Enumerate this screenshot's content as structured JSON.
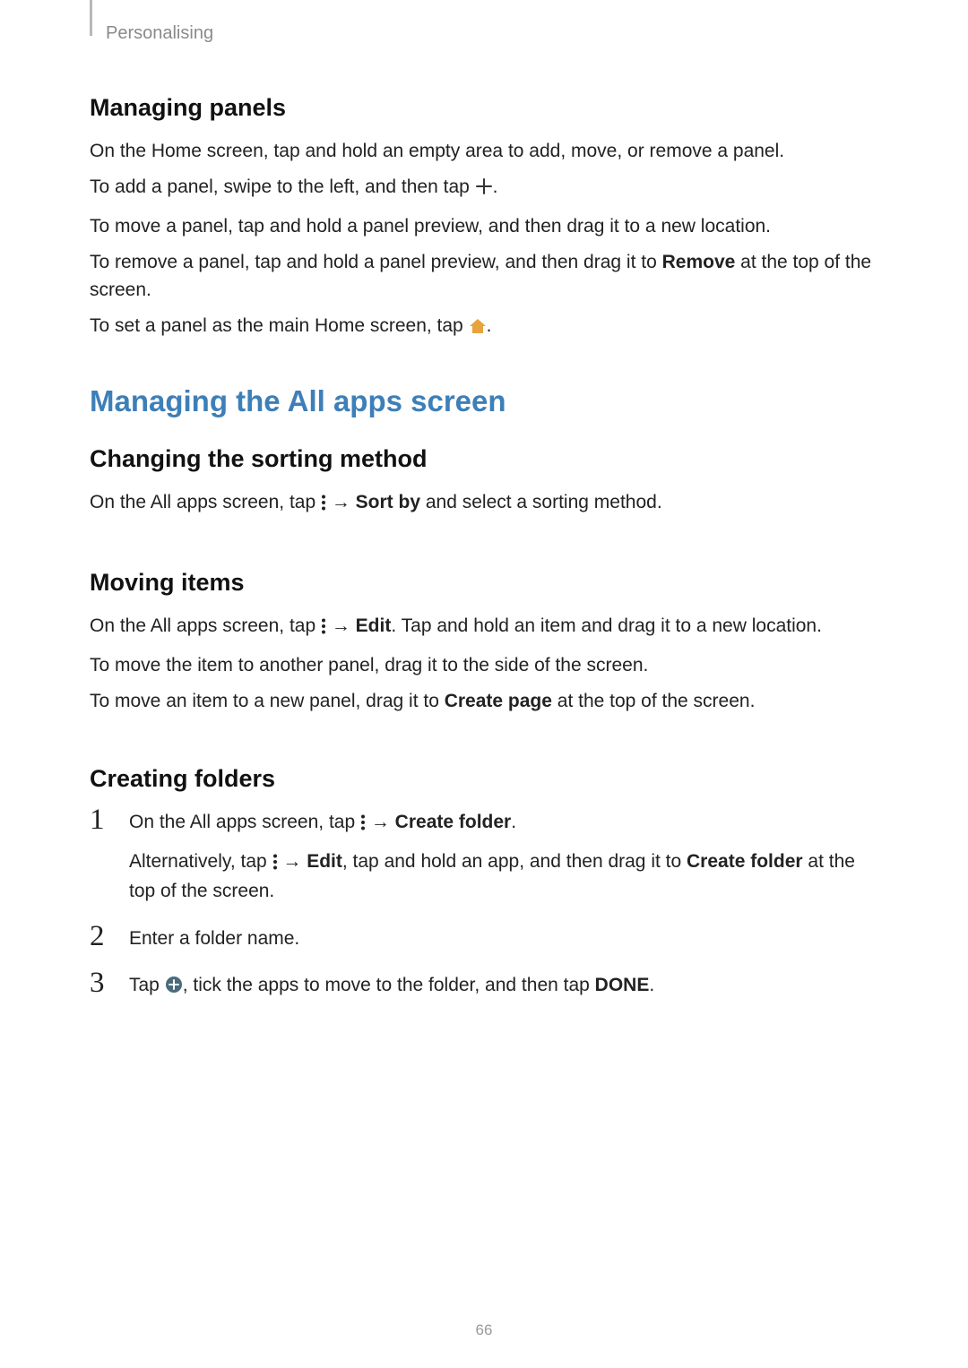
{
  "header": {
    "section": "Personalising"
  },
  "s1": {
    "title": "Managing panels",
    "p1": "On the Home screen, tap and hold an empty area to add, move, or remove a panel.",
    "p2a": "To add a panel, swipe to the left, and then tap ",
    "p2b": ".",
    "p3": "To move a panel, tap and hold a panel preview, and then drag it to a new location.",
    "p4a": "To remove a panel, tap and hold a panel preview, and then drag it to ",
    "p4_bold": "Remove",
    "p4b": " at the top of the screen.",
    "p5a": "To set a panel as the main Home screen, tap ",
    "p5b": "."
  },
  "s2": {
    "title": "Managing the All apps screen"
  },
  "s3": {
    "title": "Changing the sorting method",
    "p1a": "On the All apps screen, tap ",
    "arrow": " → ",
    "p1_bold": "Sort by",
    "p1b": " and select a sorting method."
  },
  "s4": {
    "title": "Moving items",
    "p1a": "On the All apps screen, tap ",
    "arrow": " → ",
    "p1_bold": "Edit",
    "p1b": ". Tap and hold an item and drag it to a new location.",
    "p2": "To move the item to another panel, drag it to the side of the screen.",
    "p3a": "To move an item to a new panel, drag it to ",
    "p3_bold": "Create page",
    "p3b": " at the top of the screen."
  },
  "s5": {
    "title": "Creating folders",
    "step1": {
      "p1a": "On the All apps screen, tap ",
      "arrow1": " → ",
      "bold1": "Create folder",
      "p1b": ".",
      "p2a": "Alternatively, tap ",
      "arrow2": " → ",
      "bold2": "Edit",
      "p2b": ", tap and hold an app, and then drag it to ",
      "bold3": "Create folder",
      "p2c": " at the top of the screen."
    },
    "step2": {
      "p1": "Enter a folder name."
    },
    "step3": {
      "p1a": "Tap ",
      "p1b": ", tick the apps to move to the folder, and then tap ",
      "bold1": "DONE",
      "p1c": "."
    }
  },
  "page_number": "66"
}
